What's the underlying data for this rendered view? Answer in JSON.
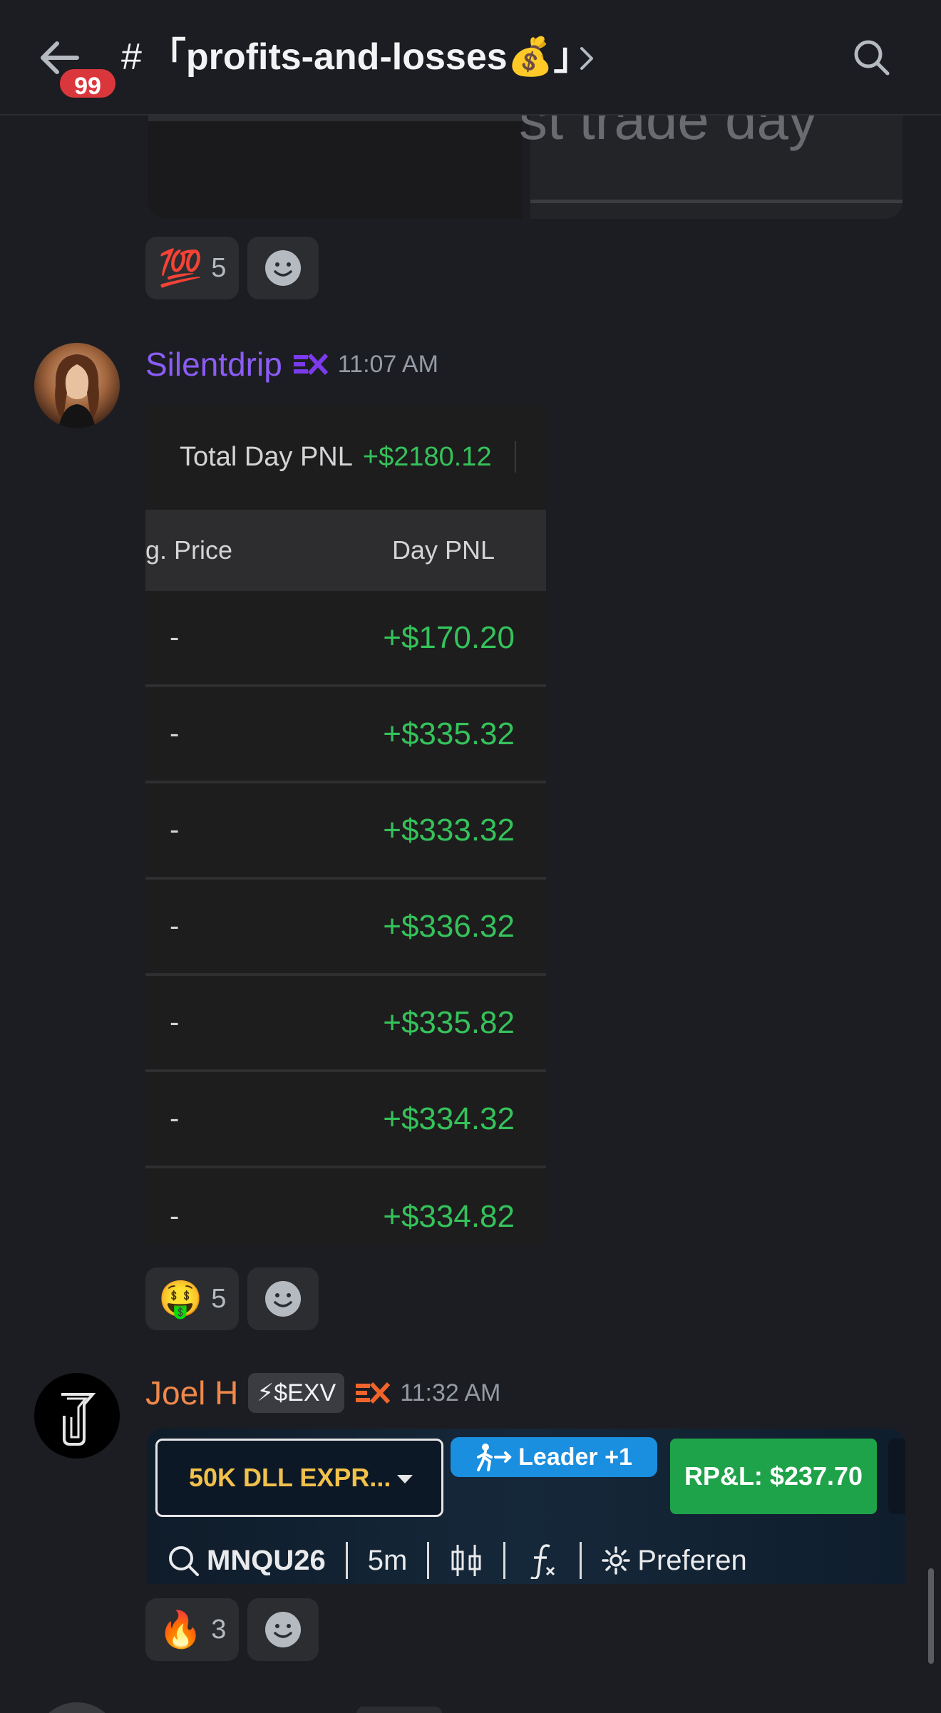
{
  "header": {
    "unread_badge": "99",
    "channel_hash": "#",
    "channel_name": "「profits-and-losses💰」"
  },
  "previous_message": {
    "image_text": "st trade day",
    "reactions": [
      {
        "emoji": "💯",
        "count": "5"
      }
    ]
  },
  "messages": [
    {
      "username": "Silentdrip",
      "username_color": "#8b5cf6",
      "role_tag": "EX",
      "timestamp": "11:07 AM",
      "embed": {
        "total_label": "Total Day PNL",
        "total_value": "+$2180.12",
        "columns": [
          "g. Price",
          "Day PNL"
        ],
        "rows": [
          [
            "-",
            "+$170.20"
          ],
          [
            "-",
            "+$335.32"
          ],
          [
            "-",
            "+$333.32"
          ],
          [
            "-",
            "+$336.32"
          ],
          [
            "-",
            "+$335.82"
          ],
          [
            "-",
            "+$334.32"
          ],
          [
            "-",
            "+$334.82"
          ]
        ]
      },
      "reactions": [
        {
          "emoji": "🤑",
          "count": "5"
        }
      ]
    },
    {
      "username": "Joel H",
      "username_color": "#f0884a",
      "badge_text": "⚡$EXV",
      "role_tag": "EX",
      "timestamp": "11:32 AM",
      "embed": {
        "account_select": "50K DLL EXPR...",
        "leader_label": "Leader +1",
        "rpl_label": "RP&L: $237.70",
        "symbol": "MNQU26",
        "interval": "5m",
        "preferences_label": "Preferen"
      },
      "reactions": [
        {
          "emoji": "🔥",
          "count": "3"
        }
      ]
    }
  ],
  "colors": {
    "background": "#1c1d22",
    "profit_green": "#35c25a",
    "badge_red": "#da373c",
    "rpl_green": "#1fa34a",
    "leader_blue": "#1a8fe0",
    "account_text": "#f2c14a"
  }
}
